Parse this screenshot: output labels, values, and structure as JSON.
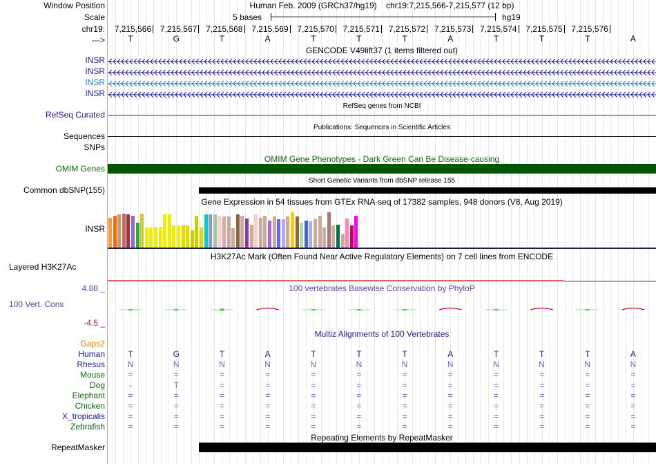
{
  "labels": {
    "window_position": "Window Position",
    "scale": "Scale",
    "chrom": "chr19:",
    "strand": "--->",
    "insr1": "INSR",
    "insr2": "INSR",
    "insr3": "INSR",
    "insr4": "INSR",
    "refseq": "RefSeq Curated",
    "sequences": "Sequences",
    "snps": "SNPs",
    "omim": "OMIM Genes",
    "dbsnp": "Common dbSNP(155)",
    "gtex_gene": "INSR",
    "h3k27ac": "Layered H3K27Ac",
    "phylop_max": "4.88 _",
    "phylop": "100 Vert. Cons",
    "phylop_min": "-4.5 _",
    "gaps": "Gaps2",
    "species": [
      "Human",
      "Rhesus",
      "Mouse",
      "Dog",
      "Elephant",
      "Chicken",
      "X_tropicalis",
      "Zebrafish"
    ],
    "repeatmasker": "RepeatMasker"
  },
  "header": {
    "assembly": "Human Feb. 2009 (GRCh37/hg19)",
    "position": "chr19:7,215,566-7,215,577 (12 bp)",
    "scale_text": "5 bases",
    "scale_db": "hg19",
    "coords": [
      "7,215,566",
      "7,215,567",
      "7,215,568",
      "7,215,569",
      "7,215,570",
      "7,215,571",
      "7,215,572",
      "7,215,573",
      "7,215,574",
      "7,215,575",
      "7,215,576"
    ]
  },
  "bases": [
    "T",
    "G",
    "T",
    "A",
    "T",
    "T",
    "T",
    "A",
    "T",
    "T",
    "T",
    "A"
  ],
  "tracks": {
    "gencode": "GENCODE V49lift37 (1 items filtered out)",
    "refseq": "RefSeq genes from NCBI",
    "publications": "Publications: Sequences in Scientific Articles",
    "omim": "OMIM Gene Phenotypes - Dark Green Can Be Disease-causing",
    "dbsnp": "Short Genetic Variants from dbSNP release 155",
    "gtex": "Gene Expression in 54 tissues from GTEx RNA-seq of 17382 samples, 948 donors (V8, Aug 2019)",
    "h3k27ac": "H3K27Ac Mark (Often Found Near Active Regulatory Elements) on 7 cell lines from ENCODE",
    "phylop": "100 vertebrates Basewise Conservation by PhyloP",
    "multiz": "Multiz Alignments of 100 Vertebrates",
    "repeatmasker": "Repeating Elements by RepeatMasker"
  },
  "alignment": {
    "Human": [
      "T",
      "G",
      "T",
      "A",
      "T",
      "T",
      "T",
      "A",
      "T",
      "T",
      "T",
      "A"
    ],
    "Rhesus": [
      "N",
      "N",
      "N",
      "N",
      "N",
      "N",
      "N",
      "N",
      "N",
      "N",
      "N",
      "N"
    ],
    "Mouse": [
      "=",
      "=",
      "=",
      "=",
      "=",
      "=",
      "=",
      "=",
      "=",
      "=",
      "=",
      "="
    ],
    "Dog": [
      "-",
      "T",
      "=",
      "=",
      "=",
      "=",
      "=",
      "=",
      "=",
      "=",
      "=",
      "="
    ],
    "Elephant": [
      "=",
      "=",
      "=",
      "=",
      "=",
      "=",
      "=",
      "=",
      "=",
      "=",
      "=",
      "="
    ],
    "Chicken": [
      "=",
      "=",
      "=",
      "=",
      "=",
      "=",
      "=",
      "=",
      "=",
      "=",
      "=",
      "="
    ],
    "X_tropicalis": [
      "=",
      "=",
      "=",
      "=",
      "=",
      "=",
      "=",
      "=",
      "=",
      "=",
      "=",
      "="
    ],
    "Zebrafish": [
      "=",
      "=",
      "=",
      "=",
      "=",
      "=",
      "=",
      "=",
      "=",
      "=",
      "=",
      "="
    ]
  },
  "gtex_values": [
    30,
    32,
    33,
    34,
    33,
    32,
    25,
    34,
    20,
    20,
    21,
    21,
    33,
    33,
    22,
    22,
    22,
    22,
    17,
    32,
    20,
    33,
    33,
    33,
    32,
    31,
    31,
    19,
    33,
    32,
    29,
    23,
    33,
    30,
    32,
    27,
    31,
    28,
    28,
    31,
    35,
    31,
    25,
    27,
    26,
    28,
    32,
    20,
    35,
    22,
    23,
    14,
    29,
    22,
    32,
    8
  ],
  "gtex_colors": [
    "#ff9933",
    "#ff6600",
    "#cc9966",
    "#cc6666",
    "#aa3333",
    "#9966cc",
    "#33aa33",
    "#cccc33",
    "#eeee00",
    "#eeee00",
    "#eeee00",
    "#eeee00",
    "#eeee00",
    "#eeee00",
    "#eeee00",
    "#eeee00",
    "#dddd00",
    "#dddd00",
    "#cccc00",
    "#cccc00",
    "#dddd00",
    "#00cccc",
    "#8899cc",
    "#99cc99",
    "#ffcccc",
    "#ddaaaa",
    "#ccaa99",
    "#ccaa99",
    "#886644",
    "#ccaa99",
    "#993399",
    "#ccaa99",
    "#ffcccc",
    "#ccaa99",
    "#ccaa99",
    "#aa66cc",
    "#ccaa99",
    "#6666ff",
    "#aaaaff",
    "#ccaa99",
    "#ffcc00",
    "#996633",
    "#aaddaa",
    "#4466dd",
    "#aaaaff",
    "#ccaa99",
    "#ccaa99",
    "#ccaa99",
    "#aa7777",
    "#ccaa99",
    "#007744",
    "#ccaa99",
    "#ff88aa",
    "#cc0066",
    "#ff00ff",
    "#ffffff"
  ],
  "colors": {
    "label_blue": "#1c1c8c",
    "insr3_blue": "#1f77b4",
    "omim_green": "#005500",
    "green_label": "#0b6b0b",
    "phylop_blue": "#4a4aa8",
    "phylop_red": "#8b2b1b",
    "gaps_orange": "#e08000",
    "h3k27ac_red": "#e06666"
  }
}
